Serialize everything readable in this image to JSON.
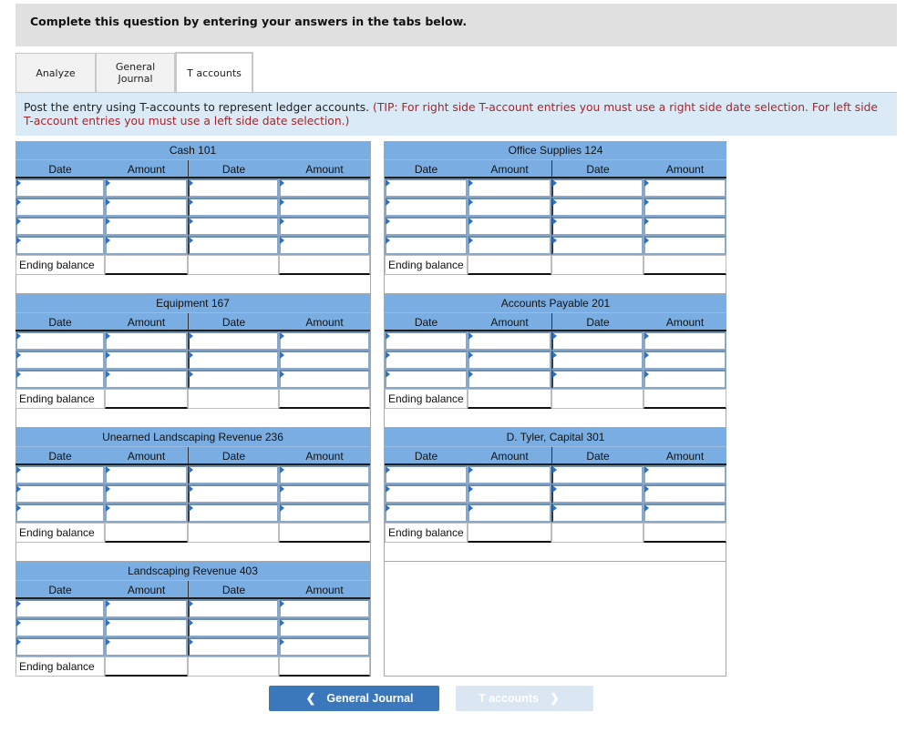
{
  "banner": {
    "text": "Complete this question by entering your answers in the tabs below."
  },
  "tabs": [
    {
      "label": "Analyze",
      "active": false
    },
    {
      "label": "General\nJournal",
      "active": false
    },
    {
      "label": "T accounts",
      "active": true
    }
  ],
  "instructions": {
    "text": "Post the entry using T-accounts to represent ledger accounts.",
    "tip": "(TIP: For right side T-account entries you must use a right side date selection. For left side T-account entries you must use a left side date selection.)"
  },
  "columns": {
    "date": "Date",
    "amount": "Amount"
  },
  "ending_balance_label": "Ending balance",
  "accounts": [
    {
      "title": "Cash 101",
      "rows": 4,
      "left_entries": [],
      "right_entries": [],
      "ending_balance_left": "",
      "ending_balance_right": ""
    },
    {
      "title": "Office Supplies 124",
      "rows": 4,
      "left_entries": [],
      "right_entries": [],
      "ending_balance_left": "",
      "ending_balance_right": ""
    },
    {
      "title": "Equipment 167",
      "rows": 3,
      "left_entries": [],
      "right_entries": [],
      "ending_balance_left": "",
      "ending_balance_right": ""
    },
    {
      "title": "Accounts Payable 201",
      "rows": 3,
      "left_entries": [],
      "right_entries": [],
      "ending_balance_left": "",
      "ending_balance_right": ""
    },
    {
      "title": "Unearned Landscaping Revenue 236",
      "rows": 3,
      "left_entries": [],
      "right_entries": [],
      "ending_balance_left": "",
      "ending_balance_right": ""
    },
    {
      "title": "D. Tyler, Capital 301",
      "rows": 3,
      "left_entries": [],
      "right_entries": [],
      "ending_balance_left": "",
      "ending_balance_right": ""
    },
    {
      "title": "Landscaping Revenue 403",
      "rows": 3,
      "left_entries": [],
      "right_entries": [],
      "ending_balance_left": "",
      "ending_balance_right": ""
    }
  ],
  "nav": {
    "prev_label": "General Journal",
    "next_label": "T accounts",
    "next_disabled": true
  },
  "colors": {
    "header_blue": "#7aaee3",
    "instr_bg": "#dbeaf7",
    "tip_red": "#a5262a",
    "button_blue": "#3a78bb",
    "button_disabled": "#dbe6f3"
  }
}
